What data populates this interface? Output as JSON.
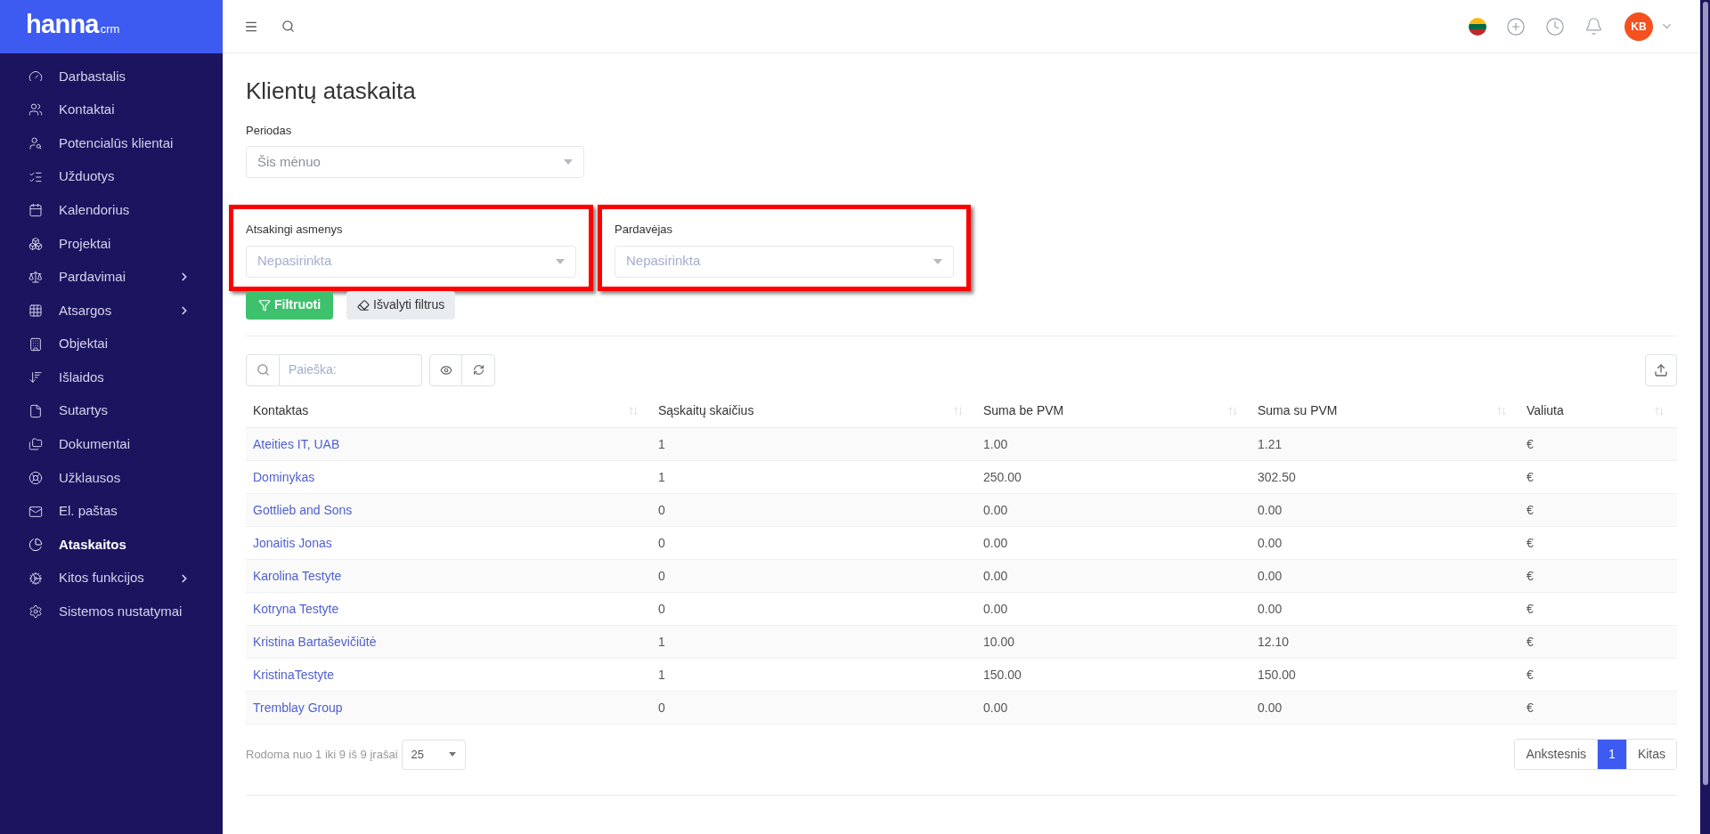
{
  "logo": {
    "name": "hanna",
    "suffix": "crm"
  },
  "sidebar": {
    "items": [
      {
        "label": "Darbastalis",
        "selected": false,
        "has_submenu": false
      },
      {
        "label": "Kontaktai",
        "selected": false,
        "has_submenu": false
      },
      {
        "label": "Potencialūs klientai",
        "selected": false,
        "has_submenu": false
      },
      {
        "label": "Užduotys",
        "selected": false,
        "has_submenu": false
      },
      {
        "label": "Kalendorius",
        "selected": false,
        "has_submenu": false
      },
      {
        "label": "Projektai",
        "selected": false,
        "has_submenu": false
      },
      {
        "label": "Pardavimai",
        "selected": false,
        "has_submenu": true
      },
      {
        "label": "Atsargos",
        "selected": false,
        "has_submenu": true
      },
      {
        "label": "Objektai",
        "selected": false,
        "has_submenu": false
      },
      {
        "label": "Išlaidos",
        "selected": false,
        "has_submenu": false
      },
      {
        "label": "Sutartys",
        "selected": false,
        "has_submenu": false
      },
      {
        "label": "Dokumentai",
        "selected": false,
        "has_submenu": false
      },
      {
        "label": "Užklausos",
        "selected": false,
        "has_submenu": false
      },
      {
        "label": "El. paštas",
        "selected": false,
        "has_submenu": false
      },
      {
        "label": "Ataskaitos",
        "selected": true,
        "has_submenu": false
      },
      {
        "label": "Kitos funkcijos",
        "selected": false,
        "has_submenu": true
      },
      {
        "label": "Sistemos nustatymai",
        "selected": false,
        "has_submenu": false
      }
    ]
  },
  "topbar": {
    "avatar": "KB"
  },
  "page": {
    "title": "Klientų ataskaita",
    "period": {
      "label": "Periodas",
      "value": "Šis mėnuo"
    },
    "filters": [
      {
        "label": "Atsakingi asmenys",
        "placeholder": "Nepasirinkta",
        "highlighted": true
      },
      {
        "label": "Pardavėjas",
        "placeholder": "Nepasirinkta",
        "highlighted": true
      }
    ],
    "buttons": {
      "filter": "Filtruoti",
      "clear": "Išvalyti filtrus"
    }
  },
  "table": {
    "search_placeholder": "Paieška:",
    "columns": [
      "Kontaktas",
      "Sąskaitų skaičius",
      "Suma be PVM",
      "Suma su PVM",
      "Valiuta"
    ],
    "rows": [
      [
        "Ateities IT, UAB",
        "1",
        "1.00",
        "1.21",
        "€"
      ],
      [
        "Dominykas",
        "1",
        "250.00",
        "302.50",
        "€"
      ],
      [
        "Gottlieb and Sons",
        "0",
        "0.00",
        "0.00",
        "€"
      ],
      [
        "Jonaitis Jonas",
        "0",
        "0.00",
        "0.00",
        "€"
      ],
      [
        "Karolina Testyte",
        "0",
        "0.00",
        "0.00",
        "€"
      ],
      [
        "Kotryna Testyte",
        "0",
        "0.00",
        "0.00",
        "€"
      ],
      [
        "Kristina Bartaševičiūtė",
        "1",
        "10.00",
        "12.10",
        "€"
      ],
      [
        "KristinaTestyte",
        "1",
        "150.00",
        "150.00",
        "€"
      ],
      [
        "Tremblay Group",
        "0",
        "0.00",
        "0.00",
        "€"
      ]
    ],
    "info": "Rodoma nuo 1 iki 9 iš 9 įrašai",
    "page_size": "25",
    "pagination": [
      {
        "label": "Ankstesnis",
        "selected": false
      },
      {
        "label": "1",
        "selected": true
      },
      {
        "label": "Kitas",
        "selected": false
      }
    ]
  }
}
